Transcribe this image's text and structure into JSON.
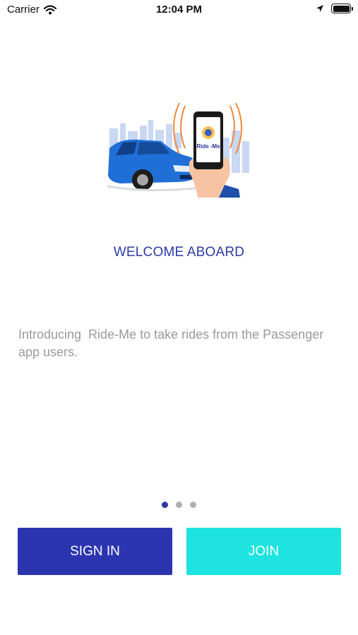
{
  "status_bar": {
    "carrier": "Carrier",
    "time": "12:04 PM",
    "icons": [
      "wifi-icon",
      "location-arrow-icon",
      "battery-icon"
    ]
  },
  "hero": {
    "phone_logo_text": "Ride -Me",
    "icons": [
      "car-illustration",
      "phone-in-hand-illustration",
      "city-skyline"
    ]
  },
  "onboarding": {
    "title": "WELCOME ABOARD",
    "description": "Introducing  Ride-Me to take rides from the Passenger app users.",
    "page_count": 3,
    "active_page": 1
  },
  "actions": {
    "sign_in_label": "SIGN IN",
    "join_label": "JOIN"
  },
  "colors": {
    "title": "#2f3aa6",
    "sign_in_bg": "#2c35b0",
    "join_bg": "#1ee3e0",
    "description": "#9a9a9a",
    "dot_active": "#2f3aa6",
    "dot_inactive": "#b0b0b0"
  }
}
